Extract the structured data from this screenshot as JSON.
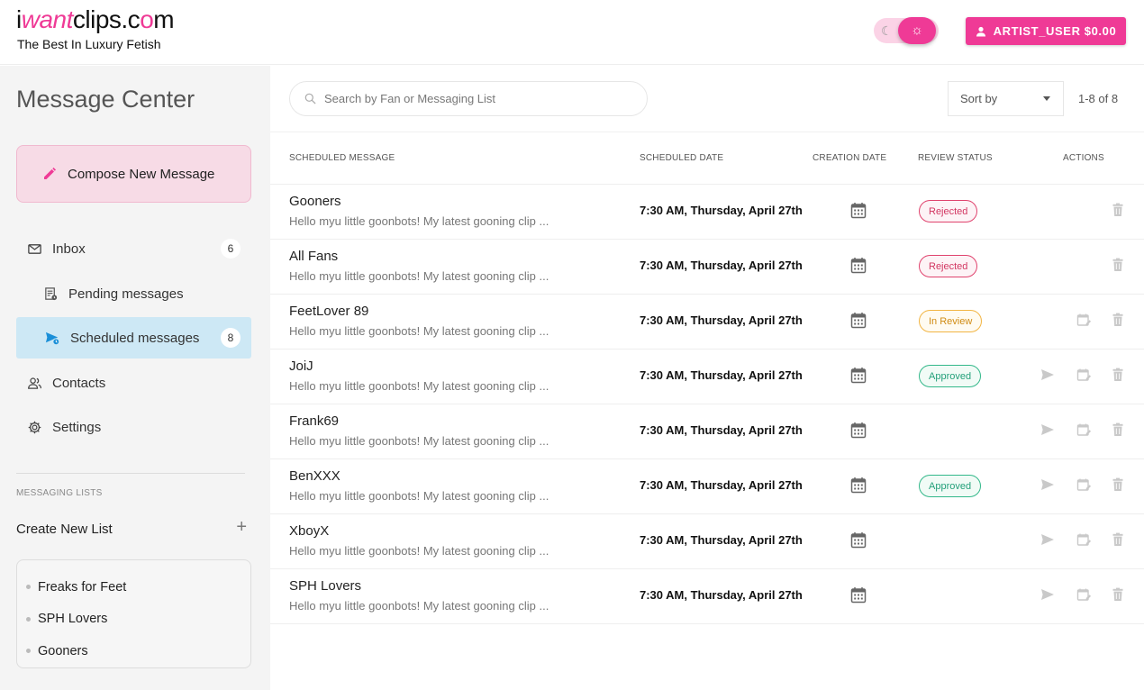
{
  "header": {
    "logo": {
      "part1": "i",
      "part2": "want",
      "part3": "clips.c",
      "part4": "o",
      "part5": "m"
    },
    "tagline": "The Best In Luxury Fetish",
    "theme_icons": [
      "moon-icon",
      "sun-icon"
    ],
    "user_button": "ARTIST_USER $0.00"
  },
  "sidebar": {
    "title": "Message Center",
    "compose_label": "Compose New Message",
    "nav": [
      {
        "label": "Inbox",
        "badge": "6",
        "icon": "mail-icon"
      },
      {
        "label": "Pending messages",
        "icon": "pending-list-icon"
      },
      {
        "label": "Scheduled messages",
        "badge": "8",
        "icon": "scheduled-send-icon",
        "active": true
      },
      {
        "label": "Contacts",
        "icon": "contacts-icon"
      },
      {
        "label": "Settings",
        "icon": "gear-icon"
      }
    ],
    "lists_heading": "MESSAGING LISTS",
    "create_list": "Create New List",
    "create_list_icon": "+",
    "lists": [
      "Freaks for Feet",
      "SPH Lovers",
      "Gooners"
    ]
  },
  "toolbar": {
    "search_placeholder": "Search by Fan or Messaging List",
    "sort_label": "Sort by",
    "pager": "1-8 of 8"
  },
  "table": {
    "headers": [
      "SCHEDULED MESSAGE",
      "SCHEDULED DATE",
      "CREATION DATE",
      "REVIEW STATUS",
      "ACTIONS"
    ],
    "rows": [
      {
        "name": "Gooners",
        "preview": "Hello myu little goonbots! My latest gooning clip ...",
        "date": "7:30 AM, Thursday, April 27th",
        "status": "Rejected"
      },
      {
        "name": "All Fans",
        "preview": "Hello myu little goonbots! My latest gooning clip ...",
        "date": "7:30 AM, Thursday, April 27th",
        "status": "Rejected"
      },
      {
        "name": "FeetLover 89",
        "preview": "Hello myu little goonbots! My latest gooning clip ...",
        "date": "7:30 AM, Thursday, April 27th",
        "status": "In Review"
      },
      {
        "name": "JoiJ",
        "preview": "Hello myu little goonbots! My latest gooning clip ...",
        "date": "7:30 AM, Thursday, April 27th",
        "status": "Approved"
      },
      {
        "name": "Frank69",
        "preview": "Hello myu little goonbots! My latest gooning clip ...",
        "date": "7:30 AM, Thursday, April 27th",
        "status": ""
      },
      {
        "name": "BenXXX",
        "preview": "Hello myu little goonbots! My latest gooning clip ...",
        "date": "7:30 AM, Thursday, April 27th",
        "status": "Approved"
      },
      {
        "name": "XboyX",
        "preview": "Hello myu little goonbots! My latest gooning clip ...",
        "date": "7:30 AM, Thursday, April 27th",
        "status": ""
      },
      {
        "name": "SPH Lovers",
        "preview": "Hello myu little goonbots! My latest gooning clip ...",
        "date": "7:30 AM, Thursday, April 27th",
        "status": ""
      }
    ]
  },
  "colors": {
    "accent": "#ef3a96",
    "active_nav": "#cde8f5",
    "compose_bg": "#f7dbe6",
    "rejected": "#d23661",
    "in_review": "#d08b12",
    "approved": "#23a07a"
  }
}
